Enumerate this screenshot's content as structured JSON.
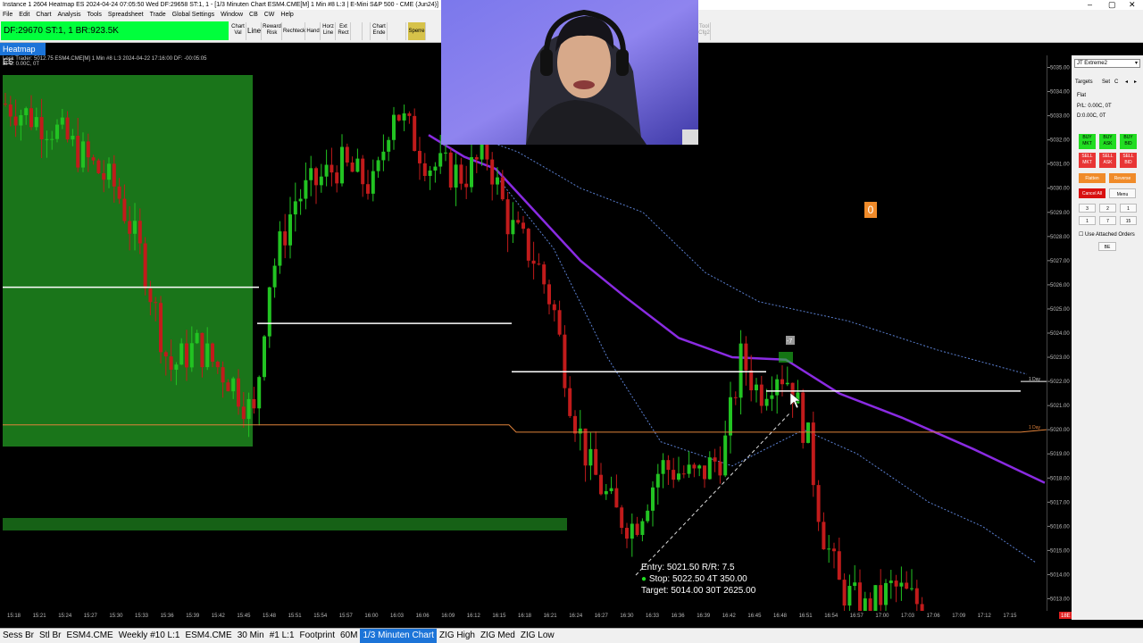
{
  "window": {
    "title": "Instance 1 2604 Heatmap ES 2024-04-24  07:05:50 Wed DF:29658  ST:1, 1 - [1/3 Minuten Chart ESM4.CME[M]  1 Min  #8 L:3 | E-Mini S&P 500 - CME (Jun24)]",
    "min": "–",
    "max": "▢",
    "close": "✕"
  },
  "menu": [
    "File",
    "Edit",
    "Chart",
    "Analysis",
    "Tools",
    "Spreadsheet",
    "Trade",
    "Global Settings",
    "Window",
    "CB",
    "CW",
    "Help"
  ],
  "status": "DF:29670  ST:1, 1    BR:923.5K",
  "toolbar": {
    "chart_val": "Chart Val",
    "line": "Line",
    "reward_risk": "Reward Risk",
    "rechteck": "Rechteck",
    "hand": "Hand",
    "horz_line": "Horz Line",
    "ext_rect": "Ext Rect",
    "chart_ende": "Chart Ende",
    "sperre": "Sperre",
    "tool_cfg": "Tool Cfg2"
  },
  "heatmap_tab": "Heatmap ES",
  "chart_info": "Lock Trader: 5012.75  ESM4.CME[M]  1 Min  #8 L:3  2024-04-22 17:16:00 DF: -00:05:05",
  "chart_info2": "BPL: 0.00C, 0T",
  "chart_data": {
    "type": "candlestick",
    "instrument": "E-Mini S&P 500 - CME (Jun24)",
    "price_ticks": [
      "5035.00",
      "5034.00",
      "5033.00",
      "5032.00",
      "5031.00",
      "5030.00",
      "5029.00",
      "5028.00",
      "5027.00",
      "5026.00",
      "5025.00",
      "5024.00",
      "5023.00",
      "5022.00",
      "5021.00",
      "5020.00",
      "5019.00",
      "5018.00",
      "5017.00",
      "5016.00",
      "5015.00",
      "5014.00",
      "5013.00"
    ],
    "time_ticks": [
      "15:18",
      "15:21",
      "15:24",
      "15:27",
      "15:30",
      "15:33",
      "15:36",
      "15:39",
      "15:42",
      "15:45",
      "15:48",
      "15:51",
      "15:54",
      "15:57",
      "16:00",
      "16:03",
      "16:06",
      "16:09",
      "16:12",
      "16:15",
      "16:18",
      "16:21",
      "16:24",
      "16:27",
      "16:30",
      "16:33",
      "16:36",
      "16:39",
      "16:42",
      "16:45",
      "16:48",
      "16:51",
      "16:54",
      "16:57",
      "17:00",
      "17:03",
      "17:06",
      "17:09",
      "17:12",
      "17:15"
    ],
    "ylim": [
      5012.5,
      5035.5
    ],
    "current_price_label": "18E",
    "right_labels": [
      "1 Day",
      "1 Day"
    ]
  },
  "trade": {
    "entry": "Entry: 5021.50  R/R: 7.5",
    "stop": "Stop: 5022.50  4T  350.00",
    "target": "Target: 5014.00  30T  2625.00"
  },
  "order_marker": "-7",
  "badge": "0",
  "panel": {
    "account": "JT Extreme2",
    "targets": "Targets",
    "set": "Set",
    "c": "C",
    "position": "Flat",
    "pl": "P/L: 0.00C, 0T",
    "d": "D:0.00C, 0T",
    "buy_mkt": "BUY MKT",
    "buy_ask": "BUY ASK",
    "buy_bid": "BUY BID",
    "sell_mkt": "SELL MKT",
    "sell_ask": "SELL ASK",
    "sell_bid": "SELL BID",
    "flatten": "Flatten",
    "reverse": "Reverse",
    "cancel_all": "Cancel All",
    "menu": "Menu",
    "qty": [
      "3",
      "2",
      "1",
      "1",
      "7",
      "15"
    ],
    "use_attached": "Use Attached Orders",
    "be": "BE"
  },
  "tabs": [
    "Sess Br",
    "Stl Br",
    "ESM4.CME",
    "Weekly #10 L:1",
    "ESM4.CME",
    "30 Min",
    "#1 L:1",
    "Footprint",
    "60M",
    "1/3 Minuten Chart",
    "ZIG High",
    "ZIG Med",
    "ZIG Low"
  ],
  "active_tab_index": 9,
  "colors": {
    "up_candle": "#22c322",
    "down_candle": "#c11b1b",
    "vwap": "#8a2be2",
    "band": "#5a7fd0",
    "highlight_zone": "#1f8a1f",
    "accent_blue": "#1c74d8"
  }
}
